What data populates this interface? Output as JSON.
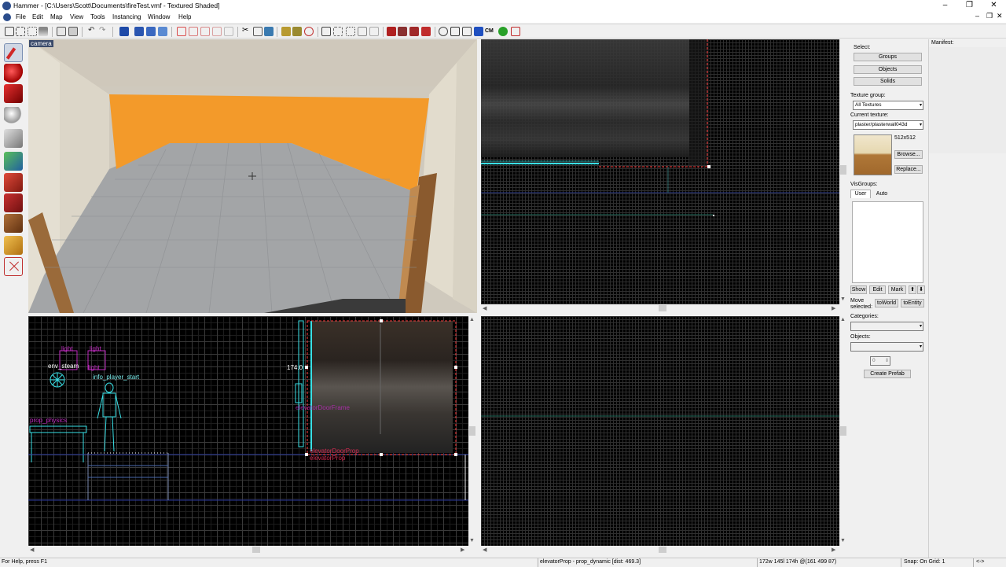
{
  "window": {
    "title": "Hammer - [C:\\Users\\Scott\\Documents\\fireTest.vmf - Textured Shaded]",
    "controls": [
      "–",
      "❐",
      "✕"
    ],
    "mdi_controls": [
      "–",
      "❐",
      "✕"
    ]
  },
  "menu": [
    "File",
    "Edit",
    "Map",
    "View",
    "Tools",
    "Instancing",
    "Window",
    "Help"
  ],
  "toolbar": {
    "cm_label": "CM"
  },
  "viewports": {
    "camera": {
      "label": "camera"
    },
    "top_left_2d": {
      "labels": {
        "light1": "light",
        "light2": "light",
        "light3": "light",
        "env_steam": "env_steam",
        "info_player_start": "info_player_start",
        "prop_physics": "prop_physics",
        "dimension": "174.0",
        "elevator_door": "elevatorDoorFrame",
        "elevator_prop1": "elevatorDoorProp",
        "elevator_prop2": "elevatorProp"
      }
    }
  },
  "right_panel": {
    "select_label": "Select:",
    "groups_btn": "Groups",
    "objects_btn": "Objects",
    "solids_btn": "Solids",
    "texture_group_label": "Texture group:",
    "texture_group_value": "All Textures",
    "current_texture_label": "Current texture:",
    "current_texture_value": "plaster/plasterwall043d",
    "texture_size": "512x512",
    "browse_btn": "Browse...",
    "replace_btn": "Replace...",
    "visgroups_label": "VisGroups:",
    "user_tab": "User",
    "auto_tab": "Auto",
    "show_btn": "Show",
    "edit_btn": "Edit",
    "mark_btn": "Mark",
    "move_selected_label": "Move selected:",
    "to_world_btn": "toWorld",
    "to_entity_btn": "toEntity",
    "categories_label": "Categories:",
    "objects_label": "Objects:",
    "spin_value": "0",
    "create_prefab_btn": "Create Prefab"
  },
  "manifest": {
    "label": "Manifest:"
  },
  "statusbar": {
    "help": "For Help, press F1",
    "selection": "elevatorProp - prop_dynamic  [dist: 469.3]",
    "dims": "172w 145l 174h @(161 499 87)",
    "snap": "Snap: On Grid: 1",
    "zoom": "<->"
  },
  "colors": {
    "orange_wall": "#f39a2a",
    "floor": "#a3a5a7",
    "wall": "#d4d0c6",
    "entity_magenta": "#c02bc0",
    "entity_cyan": "#39e0e6",
    "selection_red": "#ff4040"
  }
}
